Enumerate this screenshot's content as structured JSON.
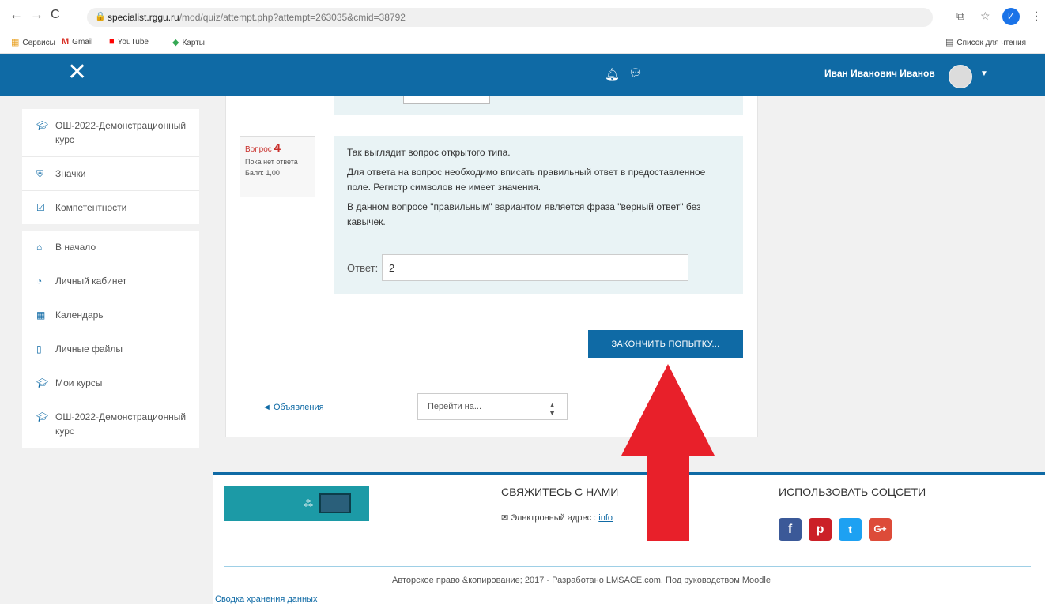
{
  "browser": {
    "url_host": "specialist.rggu.ru",
    "url_path": "/mod/quiz/attempt.php?attempt=263035&cmid=38792",
    "profile_initial": "И",
    "bookmarks": [
      "Сервисы",
      "Gmail",
      "YouTube",
      "Карты"
    ],
    "reading_list": "Список для чтения"
  },
  "header": {
    "user_name": "Иван Иванович Иванов"
  },
  "sidebar": {
    "groups": [
      [
        {
          "label": "ОШ-2022-Демонстрационный курс",
          "icon": "graduation-cap-icon"
        },
        {
          "label": "Значки",
          "icon": "shield-icon"
        },
        {
          "label": "Компетентности",
          "icon": "checkbox-icon"
        }
      ],
      [
        {
          "label": "В начало",
          "icon": "home-icon"
        },
        {
          "label": "Личный кабинет",
          "icon": "dashboard-icon"
        },
        {
          "label": "Календарь",
          "icon": "calendar-icon"
        },
        {
          "label": "Личные файлы",
          "icon": "file-icon"
        },
        {
          "label": "Мои курсы",
          "icon": "graduation-cap-icon"
        },
        {
          "label": "ОШ-2022-Демонстрационный курс",
          "icon": "graduation-cap-icon"
        }
      ]
    ]
  },
  "question": {
    "label": "Вопрос",
    "number": "4",
    "status": "Пока нет ответа",
    "score": "Балл: 1,00",
    "text1": "Так выглядит вопрос открытого типа.",
    "text2": "Для ответа на вопрос необходимо вписать правильный ответ в предоставленное поле. Регистр символов не имеет значения.",
    "text3": "В данном вопросе \"правильным\" вариантом является фраза \"верный ответ\" без кавычек.",
    "answer_label": "Ответ:",
    "answer_value": "2"
  },
  "actions": {
    "finish_label": "ЗАКОНЧИТЬ ПОПЫТКУ...",
    "prev_link": "◄ Объявления",
    "jump_label": "Перейти на..."
  },
  "footer": {
    "contact_heading": "СВЯЖИТЕСЬ С НАМИ",
    "email_label": "Электронный адрес :",
    "email_link": "info",
    "social_heading": "ИСПОЛЬЗОВАТЬ СОЦСЕТИ",
    "copyright": "Авторское право &копирование; 2017 - Разработано LMSACE.com. Под руководством Moodle",
    "data_summary": "Сводка хранения данных"
  },
  "colors": {
    "brand": "#0f6aa5",
    "arrow": "#e8202a",
    "question_bg": "#e9f3f5"
  }
}
